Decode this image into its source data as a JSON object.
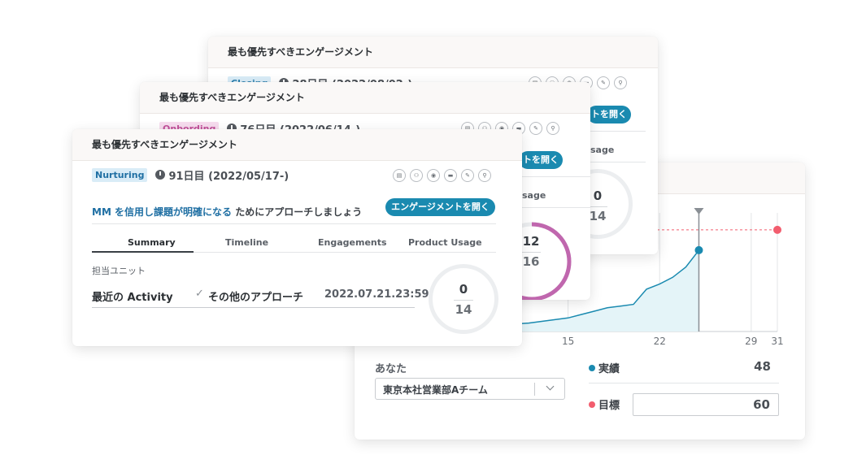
{
  "card_back": {
    "title": "最も優先すべきエンゲージメント",
    "badge": "Closing",
    "days": "28日目 (2022/08/02-)",
    "button": "トを開く",
    "tab_usage": "sage",
    "ring_num": "0",
    "ring_den": "14"
  },
  "card_mid": {
    "title": "最も優先すべきエンゲージメント",
    "badge": "Onbording",
    "days": "76日目 (2022/06/14-)",
    "button": "トを開く",
    "tab_usage": "sage",
    "ring_num": "12",
    "ring_den": "16"
  },
  "card_front": {
    "title": "最も優先すべきエンゲージメント",
    "badge": "Nurturing",
    "days": "91日目 (2022/05/17-)",
    "message_highlight": "MM を信用し課題が明確になる",
    "message_rest": " ためにアプローチしましょう",
    "button": "エンゲージメントを開く",
    "tabs": [
      "Summary",
      "Timeline",
      "Engagements",
      "Product Usage"
    ],
    "section_label": "担当ユニット",
    "activity_label": "最近の Activity",
    "activity_check": "✓",
    "activity_type": "その他のアプローチ",
    "activity_date": "2022.07.21.23:59",
    "ring_num": "0",
    "ring_den": "14"
  },
  "icons": [
    "doc-icon",
    "people-icon",
    "target-icon",
    "chat-icon",
    "pen-icon",
    "person-icon"
  ],
  "icon_glyphs": [
    "▤",
    "⚇",
    "◉",
    "▬",
    "✎",
    "⚲"
  ],
  "chart_card": {
    "x_ticks": [
      "15",
      "22",
      "29",
      "31"
    ],
    "you_label": "あなた",
    "team_select": "東京本社営業部Aチーム",
    "actual_label": "実績",
    "actual_value": "48",
    "target_label": "目標",
    "target_value": "60"
  },
  "chart_data": {
    "type": "area",
    "x": [
      10,
      12,
      13,
      14,
      15,
      16,
      17,
      18,
      19,
      20,
      21,
      22,
      23,
      24,
      25
    ],
    "values": [
      4,
      5,
      6,
      7,
      8,
      10,
      12,
      14,
      15,
      16,
      25,
      28,
      32,
      38,
      48
    ],
    "target": 60,
    "marker_x": 25,
    "xlim": [
      8,
      31
    ],
    "ylim": [
      0,
      70
    ],
    "ticks": [
      15,
      22,
      29,
      31
    ]
  },
  "colors": {
    "accent": "#1a8ab0",
    "target": "#f25d6e",
    "closing_bg": "#d9ecf7",
    "closing_fg": "#2b7fae",
    "onbording_bg": "#f6dcee",
    "onbording_fg": "#c2509a",
    "nurturing_bg": "#d9ecf7",
    "nurturing_fg": "#1f6fa3",
    "ring_track": "#eceef0",
    "ring_purple": "#c067ae"
  }
}
